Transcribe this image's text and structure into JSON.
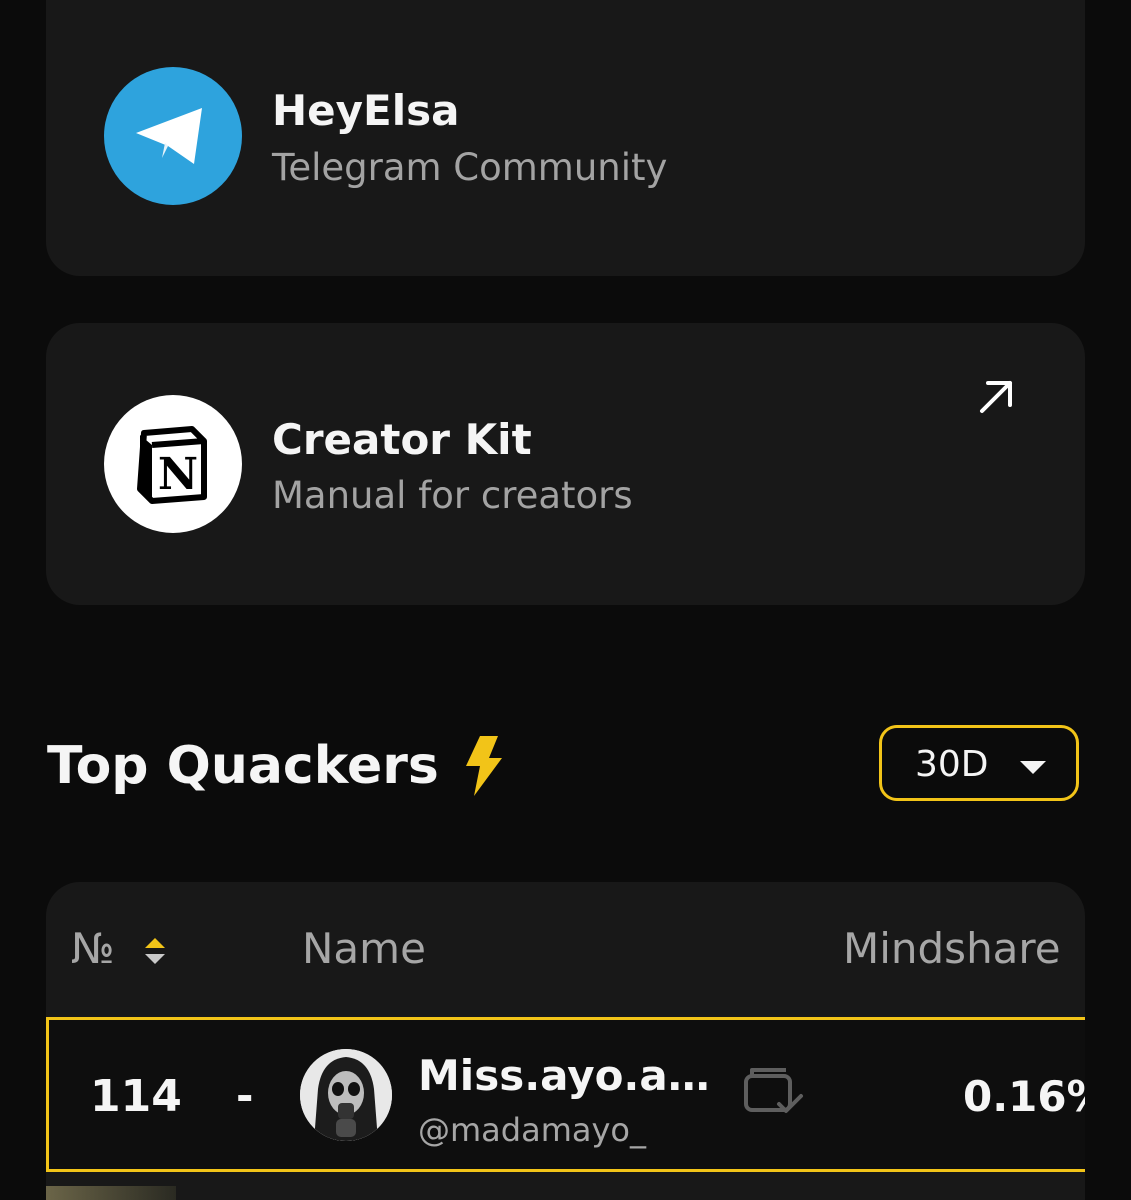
{
  "cards": [
    {
      "title": "HeyElsa",
      "subtitle": "Telegram Community",
      "icon": "telegram-icon",
      "icon_bg": "#2ea3dd"
    },
    {
      "title": "Creator Kit",
      "subtitle": "Manual for creators",
      "icon": "notion-icon",
      "icon_bg": "#ffffff",
      "link_icon": "external-link-icon"
    }
  ],
  "leaderboard": {
    "title": "Top Quackers",
    "title_icon": "bolt-icon",
    "period": "30D",
    "accent": "#f2c418",
    "columns": {
      "rank": "№",
      "name": "Name",
      "mindshare": "Mindshare"
    },
    "rows": [
      {
        "rank": "114",
        "change": "-",
        "name": "Miss.ayo.a…",
        "handle": "@madamayo_",
        "mindshare": "0.16%",
        "status_icon": "wallet-verified-icon"
      }
    ]
  }
}
